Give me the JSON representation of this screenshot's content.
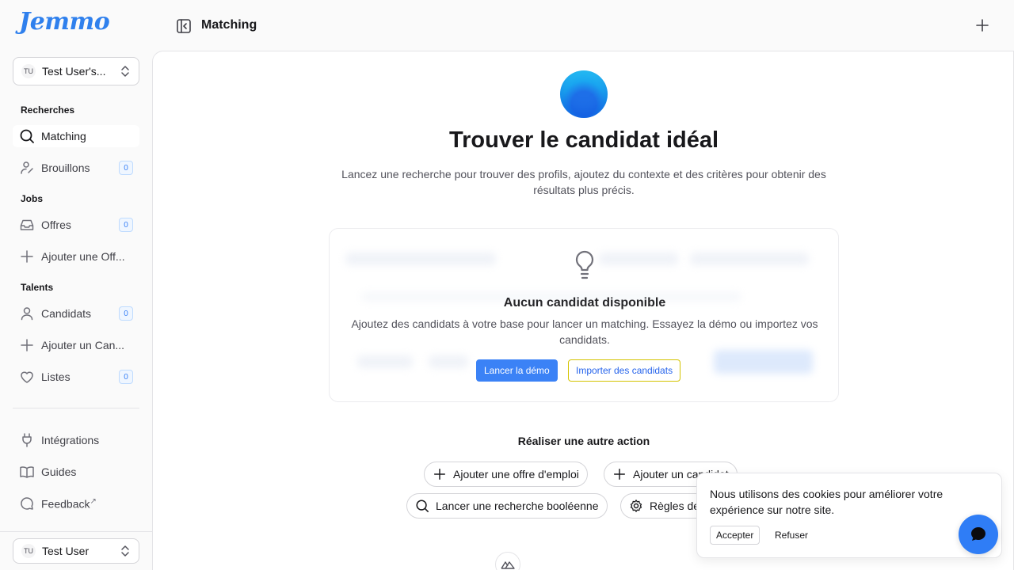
{
  "app": {
    "logo": "Jemmo"
  },
  "workspace": {
    "avatar": "TU",
    "name": "Test User's..."
  },
  "sidebar": {
    "sections": [
      {
        "label": "Recherches"
      },
      {
        "label": "Jobs"
      },
      {
        "label": "Talents"
      }
    ],
    "items": [
      {
        "label": "Matching",
        "icon": "search-icon"
      },
      {
        "label": "Brouillons",
        "icon": "user-draft-icon",
        "count": "0"
      },
      {
        "label": "Offres",
        "icon": "inbox-icon",
        "count": "0"
      },
      {
        "label": "Ajouter une Off...",
        "icon": "plus-icon"
      },
      {
        "label": "Candidats",
        "icon": "user-icon",
        "count": "0"
      },
      {
        "label": "Ajouter un Can...",
        "icon": "plus-icon"
      },
      {
        "label": "Listes",
        "icon": "heart-icon",
        "count": "0"
      }
    ],
    "footer_items": [
      {
        "label": "Intégrations",
        "icon": "plug-icon"
      },
      {
        "label": "Guides",
        "icon": "book-icon"
      },
      {
        "label": "Feedback",
        "icon": "message-icon",
        "external": "↗"
      }
    ]
  },
  "user": {
    "avatar": "TU",
    "name": "Test User"
  },
  "header": {
    "title": "Matching"
  },
  "hero": {
    "title": "Trouver le candidat idéal",
    "subtitle": "Lancez une recherche pour trouver des profils, ajoutez du contexte et des critères pour obtenir des résultats plus précis."
  },
  "empty_state": {
    "title": "Aucun candidat disponible",
    "subtitle": "Ajoutez des candidats à votre base pour lancer un matching. Essayez la démo ou importez vos candidats.",
    "demo_button": "Lancer la démo",
    "import_button": "Importer des candidats"
  },
  "other_actions": {
    "title": "Réaliser une autre action",
    "pills": [
      {
        "label": "Ajouter une offre d'emploi",
        "icon": "plus-icon"
      },
      {
        "label": "Ajouter un candidat",
        "icon": "plus-icon"
      },
      {
        "label": "Lancer une recherche booléenne",
        "icon": "search-icon"
      },
      {
        "label": "Règles de",
        "icon": "gear-icon"
      }
    ]
  },
  "cookie": {
    "text": "Nous utilisons des cookies pour améliorer votre expérience sur notre site.",
    "accept": "Accepter",
    "refuse": "Refuser"
  },
  "colors": {
    "brand": "#2f80ed",
    "primary": "#3b82f6",
    "chat": "#2f7df6"
  }
}
